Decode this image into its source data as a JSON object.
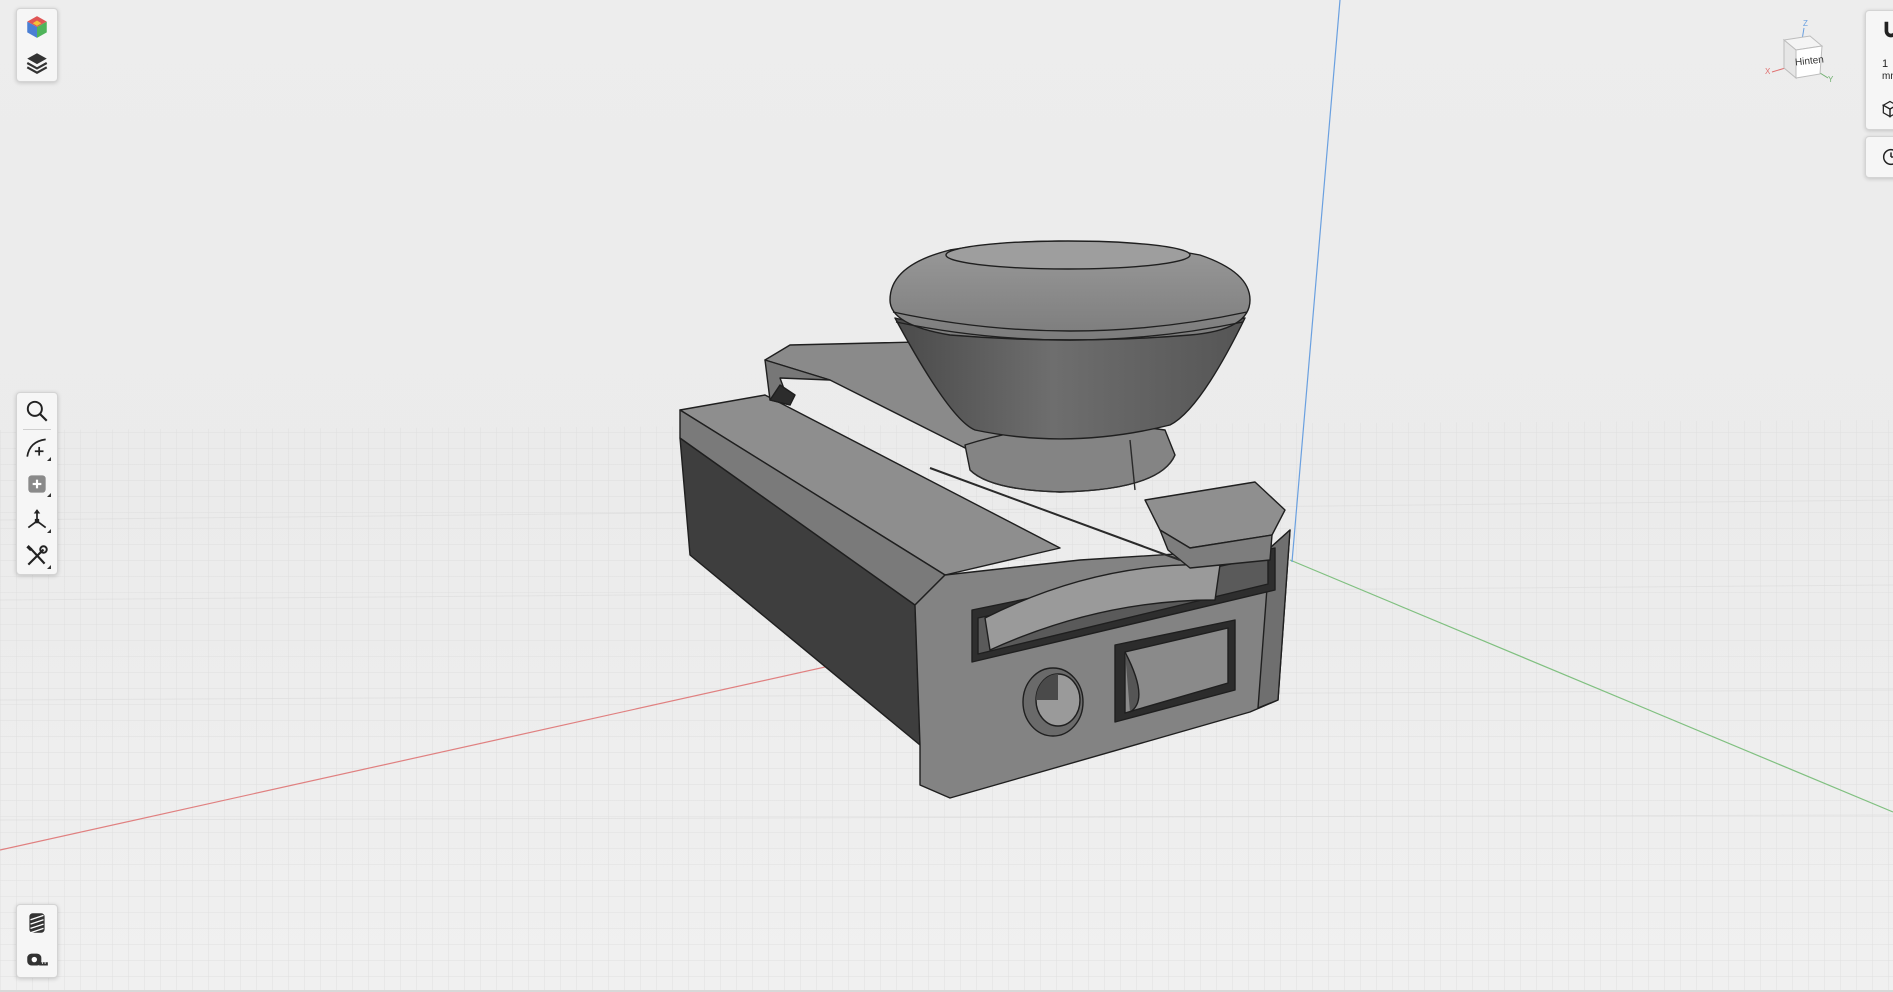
{
  "viewcube": {
    "face_label": "Hinten",
    "axis_x": "X",
    "axis_y": "Y",
    "axis_z": "Z"
  },
  "units": {
    "value": "1",
    "unit": "mm"
  },
  "icons": {
    "appearance": "color-cube-icon",
    "layers": "layers-icon",
    "search": "search-icon",
    "sketch": "sketch-arc-icon",
    "create": "add-square-icon",
    "transform": "transform-axes-icon",
    "tools": "tools-icon",
    "material": "material-hatch-icon",
    "measure": "tape-measure-icon",
    "snap": "magnet-icon",
    "view": "cube-icon",
    "history": "clock-icon"
  },
  "colors": {
    "background": "#ececec",
    "grid": "#d7d7d7",
    "x_axis": "#e08080",
    "y_axis": "#80c080",
    "z_axis": "#6aa0e0",
    "model": "#8c8c8c"
  }
}
